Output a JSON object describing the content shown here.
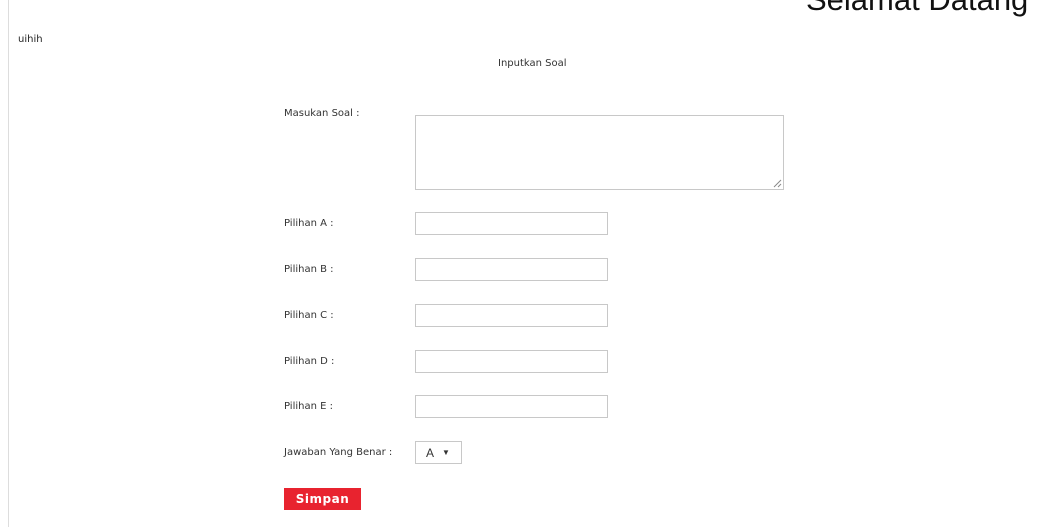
{
  "header": {
    "welcome_text": "Selamat Datang",
    "user_name": "uihih"
  },
  "form": {
    "title": "Inputkan Soal",
    "question_label": "Masukan Soal :",
    "question_value": "",
    "option_a_label": "Pilihan A :",
    "option_a_value": "",
    "option_b_label": "Pilihan B :",
    "option_b_value": "",
    "option_c_label": "Pilihan C :",
    "option_c_value": "",
    "option_d_label": "Pilihan D :",
    "option_d_value": "",
    "option_e_label": "Pilihan E :",
    "option_e_value": "",
    "answer_label": "Jawaban Yang Benar :",
    "answer_selected": "A",
    "submit_label": "Simpan"
  },
  "colors": {
    "submit_button_bg": "#e8232f",
    "input_border": "#c8c8c8"
  },
  "icons": {
    "select_arrow": "dropdown-arrow-icon",
    "resize_grip": "resize-grip-icon"
  }
}
